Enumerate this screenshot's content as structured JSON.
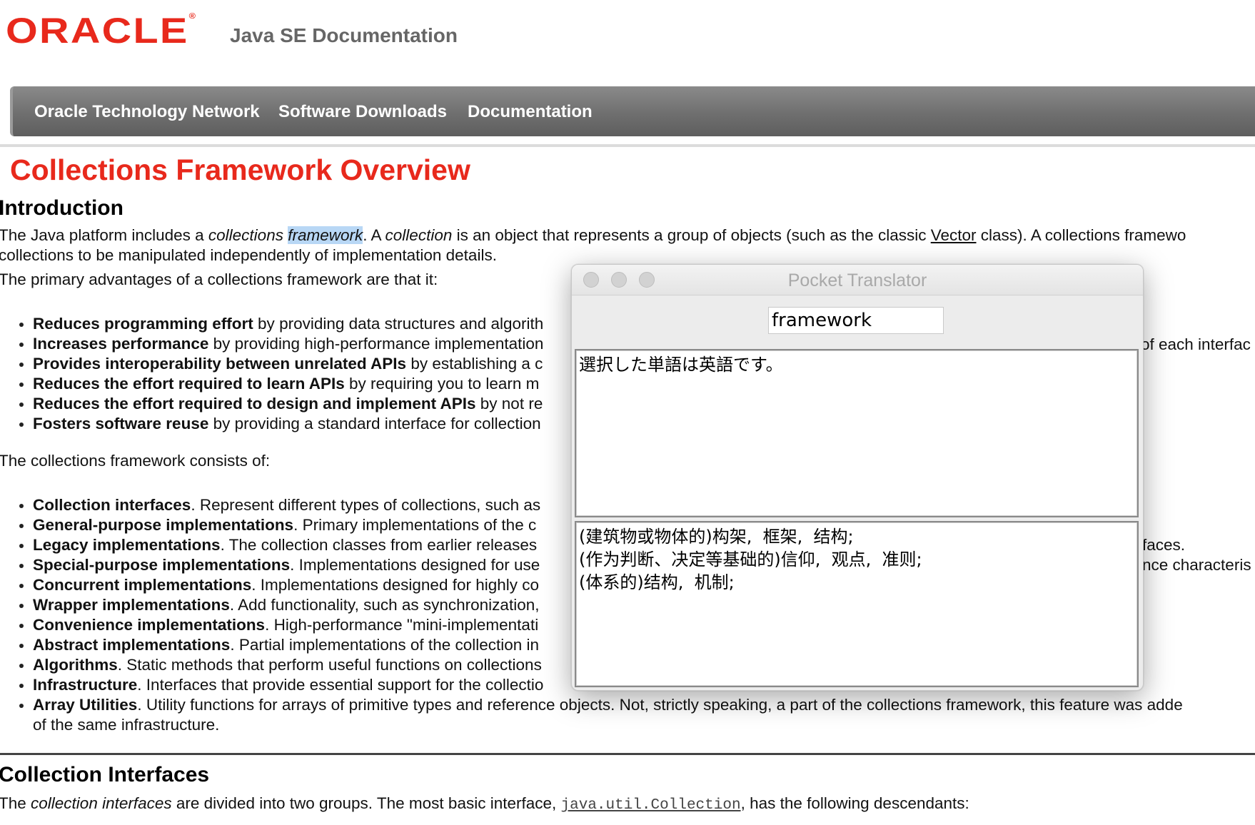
{
  "header": {
    "logo_text": "ORACLE",
    "logo_reg": "®",
    "doc_title": "Java SE Documentation"
  },
  "nav": {
    "items": [
      "Oracle Technology Network",
      "Software Downloads",
      "Documentation"
    ]
  },
  "page": {
    "title": "Collections Framework Overview",
    "intro_heading": "Introduction",
    "intro_p1_a": "The Java platform includes a ",
    "intro_p1_b": "collections",
    "intro_p1_c": " ",
    "intro_p1_d": "framework",
    "intro_p1_e": ". A ",
    "intro_p1_f": "collection",
    "intro_p1_g": " is an object that represents a group of objects (such as the classic ",
    "intro_p1_h": "Vector",
    "intro_p1_i": " class). A collections framewo",
    "intro_p1_line2": "collections to be manipulated independently of implementation details.",
    "intro_p2": "The primary advantages of a collections framework are that it:",
    "advantages": [
      {
        "bold": "Reduces programming effort",
        "text": " by providing data structures and algorith"
      },
      {
        "bold": "Increases performance",
        "text": " by providing high-performance implementation",
        "tail": "of each interfac"
      },
      {
        "bold": "Provides interoperability between unrelated APIs",
        "text": " by establishing a c"
      },
      {
        "bold": "Reduces the effort required to learn APIs",
        "text": " by requiring you to learn m"
      },
      {
        "bold": "Reduces the effort required to design and implement APIs",
        "text": " by not re"
      },
      {
        "bold": "Fosters software reuse",
        "text": " by providing a standard interface for collection"
      }
    ],
    "consists_of": "The collections framework consists of:",
    "components": [
      {
        "bold": "Collection interfaces",
        "text": ". Represent different types of collections, such as"
      },
      {
        "bold": "General-purpose implementations",
        "text": ". Primary implementations of the c"
      },
      {
        "bold": "Legacy implementations",
        "text": ". The collection classes from earlier releases",
        "tail": "faces."
      },
      {
        "bold": "Special-purpose implementations",
        "text": ". Implementations designed for use",
        "tail": "nce characteris"
      },
      {
        "bold": "Concurrent implementations",
        "text": ". Implementations designed for highly co"
      },
      {
        "bold": "Wrapper implementations",
        "text": ". Add functionality, such as synchronization,"
      },
      {
        "bold": "Convenience implementations",
        "text": ". High-performance \"mini-implementati"
      },
      {
        "bold": "Abstract implementations",
        "text": ". Partial implementations of the collection in"
      },
      {
        "bold": "Algorithms",
        "text": ". Static methods that perform useful functions on collections"
      },
      {
        "bold": "Infrastructure",
        "text": ". Interfaces that provide essential support for the collectio"
      },
      {
        "bold": "Array Utilities",
        "text": ". Utility functions for arrays of primitive types and reference objects. Not, strictly speaking, a part of the collections framework, this feature was adde"
      }
    ],
    "array_utilities_line2": "of the same infrastructure.",
    "interfaces_heading": "Collection Interfaces",
    "interfaces_p_a": "The ",
    "interfaces_p_b": "collection interfaces",
    "interfaces_p_c": " are divided into two groups. The most basic interface, ",
    "interfaces_p_code": "java.util.Collection",
    "interfaces_p_d": ", has the following descendants:"
  },
  "translator": {
    "window_title": "Pocket Translator",
    "input_value": "framework",
    "detected_text": "選択した単語は英語です。",
    "translations": [
      "(建筑物或物体的)构架,  框架,  结构;",
      "(作为判断、决定等基础的)信仰,  观点,  准则;",
      "(体系的)结构,  机制;"
    ]
  }
}
